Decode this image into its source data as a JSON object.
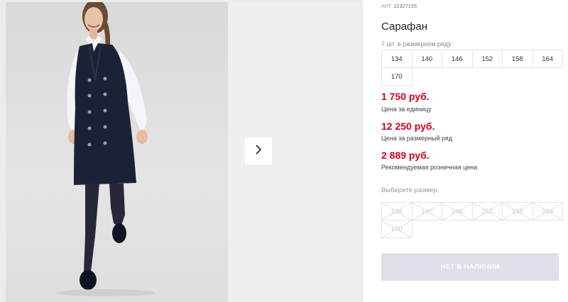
{
  "product": {
    "art_label": "АРТ.",
    "art_number": "22327155",
    "title": "Сарафан",
    "sizes_caption": "7 шт. в размерном ряду",
    "sizes": [
      "134",
      "140",
      "146",
      "152",
      "158",
      "164",
      "170"
    ]
  },
  "prices": [
    {
      "value": "1 750 руб.",
      "note": "Цена за единицу"
    },
    {
      "value": "12 250 руб.",
      "note": "Цена за размерный ряд"
    },
    {
      "value": "2 889 руб.",
      "note": "Рекомендуемая розничная цена"
    }
  ],
  "size_picker": {
    "label": "Выберите размер:",
    "options": [
      "134",
      "140",
      "146",
      "152",
      "158",
      "164",
      "170"
    ]
  },
  "cta": {
    "label": "НЕТ В НАЛИЧИИ"
  },
  "gallery": {
    "next_icon": "chevron-right-icon"
  },
  "colors": {
    "price_red": "#d0021b",
    "cta_bg": "#e2dde8",
    "dress_navy": "#1c2236",
    "gallery_bg": "#ececec"
  }
}
